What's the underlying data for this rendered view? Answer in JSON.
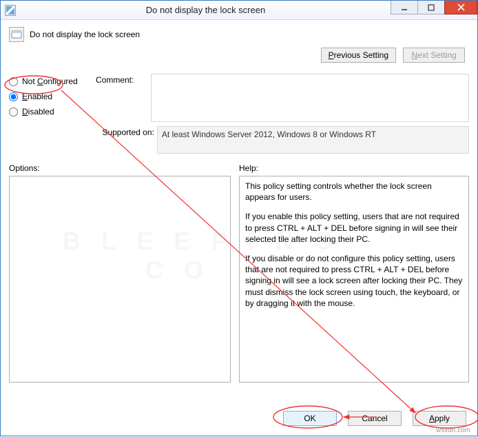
{
  "window": {
    "title": "Do not display the lock screen"
  },
  "heading": "Do not display the lock screen",
  "nav": {
    "previous": "Previous Setting",
    "next": "Next Setting"
  },
  "state": {
    "not_configured": {
      "label_html": "Not <u>C</u>onfigured",
      "label": "Not Configured",
      "checked": false
    },
    "enabled": {
      "label_html": "<u>E</u>nabled",
      "label": "Enabled",
      "checked": true
    },
    "disabled": {
      "label_html": "<u>D</u>isabled",
      "label": "Disabled",
      "checked": false
    }
  },
  "comment": {
    "label": "Comment:",
    "value": ""
  },
  "supported": {
    "label": "Supported on:",
    "value": "At least Windows Server 2012, Windows 8 or Windows RT"
  },
  "options": {
    "label": "Options:",
    "content": ""
  },
  "help": {
    "label": "Help:",
    "p1": "This policy setting controls whether the lock screen appears for users.",
    "p2": "If you enable this policy setting, users that are not required to press CTRL + ALT + DEL before signing in will see their selected tile after  locking their PC.",
    "p3": "If you disable or do not configure this policy setting, users that are not required to press CTRL + ALT + DEL before signing in will see a lock screen after locking their PC. They must dismiss the lock screen using touch, the keyboard, or by dragging it with the mouse."
  },
  "buttons": {
    "ok": "OK",
    "cancel": "Cancel",
    "apply": "Apply"
  },
  "watermark_small": "wsxdn.com",
  "watermark_big": "B L E E P I N G\n      C O"
}
